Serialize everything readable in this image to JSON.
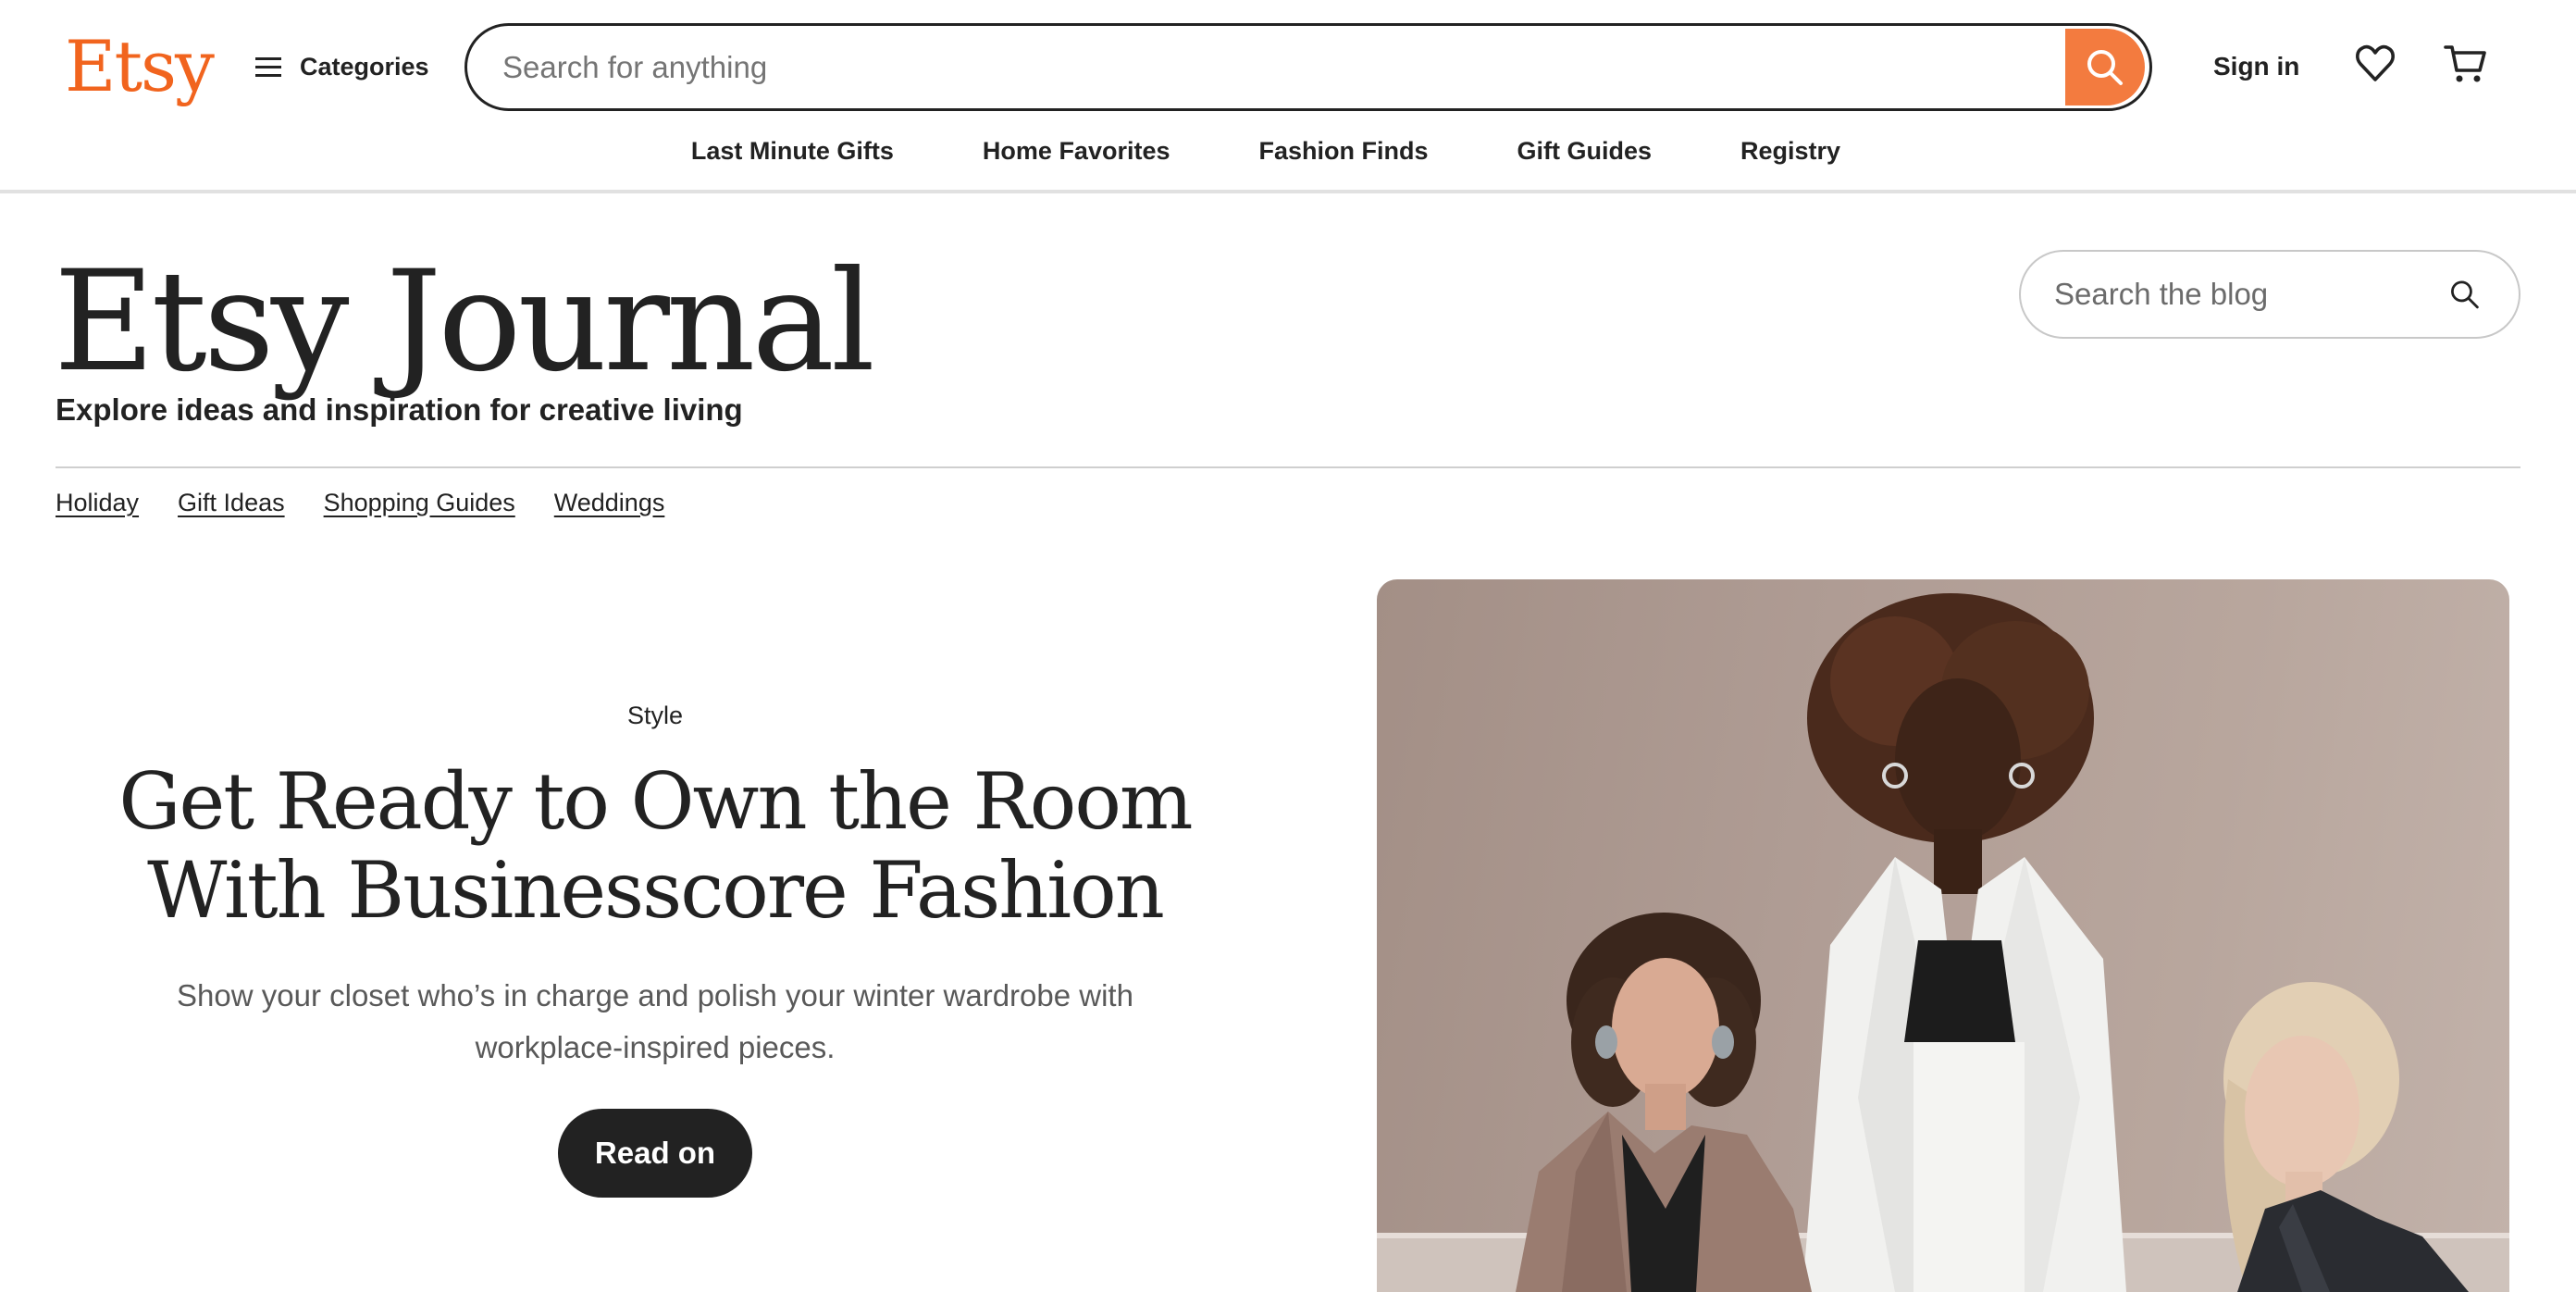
{
  "header": {
    "logo": "Etsy",
    "categories_label": "Categories",
    "search_placeholder": "Search for anything",
    "sign_in": "Sign in",
    "nav": [
      "Last Minute Gifts",
      "Home Favorites",
      "Fashion Finds",
      "Gift Guides",
      "Registry"
    ],
    "icons": {
      "menu": "hamburger-icon",
      "search": "search-icon",
      "favorites": "heart-icon",
      "cart": "cart-icon"
    },
    "accent_color": "#F1641E"
  },
  "journal": {
    "title": "Etsy Journal",
    "tagline": "Explore ideas and inspiration for creative living",
    "search_placeholder": "Search the blog",
    "category_links": [
      "Holiday",
      "Gift Ideas",
      "Shopping Guides",
      "Weddings"
    ]
  },
  "feature": {
    "category": "Style",
    "title_line1": "Get Ready to Own the Room",
    "title_line2": "With Businesscore Fashion",
    "description": "Show your closet who’s in charge and polish your winter wardrobe with workplace-inspired pieces.",
    "cta": "Read on",
    "image_subject": "three-women-in-business-attire-photo"
  }
}
